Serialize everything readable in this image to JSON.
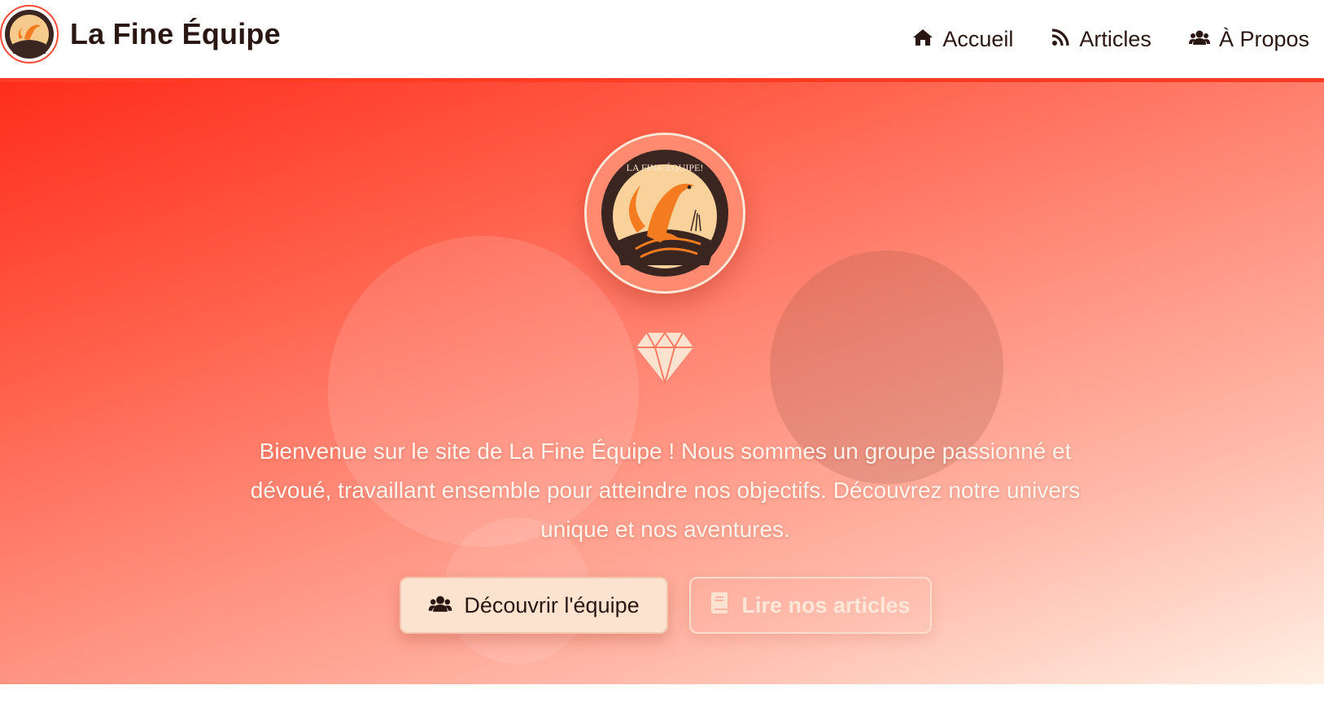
{
  "brand": {
    "name": "La Fine Équipe",
    "logo_icon": "lizard-logo-icon"
  },
  "nav": {
    "items": [
      {
        "label": "Accueil",
        "icon": "home-icon"
      },
      {
        "label": "Articles",
        "icon": "rss-icon"
      },
      {
        "label": "À Propos",
        "icon": "users-icon"
      }
    ]
  },
  "hero": {
    "logo_text": "LA FINE ÉQUIPE!",
    "logo_icon": "lizard-logo-icon",
    "accent_icon": "diamond-icon",
    "description": "Bienvenue sur le site de La Fine Équipe ! Nous sommes un groupe passionné et dévoué, travaillant ensemble pour atteindre nos objectifs. Découvrez notre univers unique et nos aventures.",
    "buttons": {
      "primary": {
        "label": "Découvrir l'équipe",
        "icon": "users-icon"
      },
      "secondary": {
        "label": "Lire nos articles",
        "icon": "book-icon"
      }
    }
  },
  "colors": {
    "accent": "#ff3b24",
    "text_dark": "#2a1713",
    "button_light": "#fbe3cf"
  }
}
